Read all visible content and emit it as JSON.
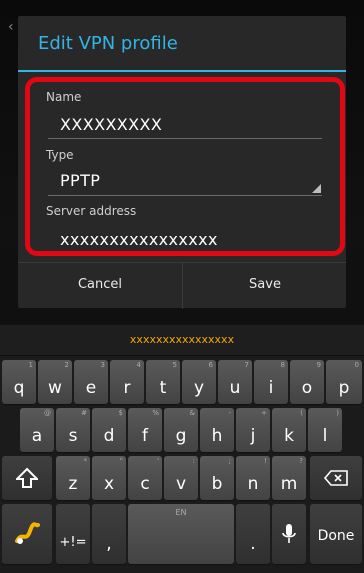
{
  "dialog": {
    "title": "Edit VPN profile",
    "fields": [
      {
        "label": "Name",
        "value": "XXXXXXXXX"
      },
      {
        "label": "Type",
        "value": "PPTP"
      },
      {
        "label": "Server address",
        "value": "xxxxxxxxxxxxxxxx"
      }
    ],
    "cancel_label": "Cancel",
    "save_label": "Save"
  },
  "suggestion": "xxxxxxxxxxxxxxxx",
  "keyboard": {
    "row1": [
      {
        "key": "q",
        "sub": "1"
      },
      {
        "key": "w",
        "sub": "2"
      },
      {
        "key": "e",
        "sub": "3"
      },
      {
        "key": "r",
        "sub": "4"
      },
      {
        "key": "t",
        "sub": "5"
      },
      {
        "key": "y",
        "sub": "6"
      },
      {
        "key": "u",
        "sub": "7"
      },
      {
        "key": "i",
        "sub": "8"
      },
      {
        "key": "o",
        "sub": "9"
      },
      {
        "key": "p",
        "sub": "0"
      }
    ],
    "row2": [
      {
        "key": "a",
        "sub": "@"
      },
      {
        "key": "s",
        "sub": "#"
      },
      {
        "key": "d",
        "sub": "$"
      },
      {
        "key": "f",
        "sub": "%"
      },
      {
        "key": "g",
        "sub": "&"
      },
      {
        "key": "h",
        "sub": "-"
      },
      {
        "key": "j",
        "sub": "+"
      },
      {
        "key": "k",
        "sub": "("
      },
      {
        "key": "l",
        "sub": ")"
      }
    ],
    "row3": [
      {
        "key": "z",
        "sub": "*"
      },
      {
        "key": "x",
        "sub": "\""
      },
      {
        "key": "c",
        "sub": "'"
      },
      {
        "key": "v",
        "sub": ":"
      },
      {
        "key": "b",
        "sub": ";"
      },
      {
        "key": "n",
        "sub": "!"
      },
      {
        "key": "m",
        "sub": "?"
      }
    ],
    "symbols_label": "+!=",
    "comma_label": ",",
    "space_label": "EN",
    "period_label": ".",
    "done_label": "Done"
  },
  "colors": {
    "accent": "#32b5e5",
    "highlight": "#e30613",
    "suggestion": "#f6a40f"
  }
}
